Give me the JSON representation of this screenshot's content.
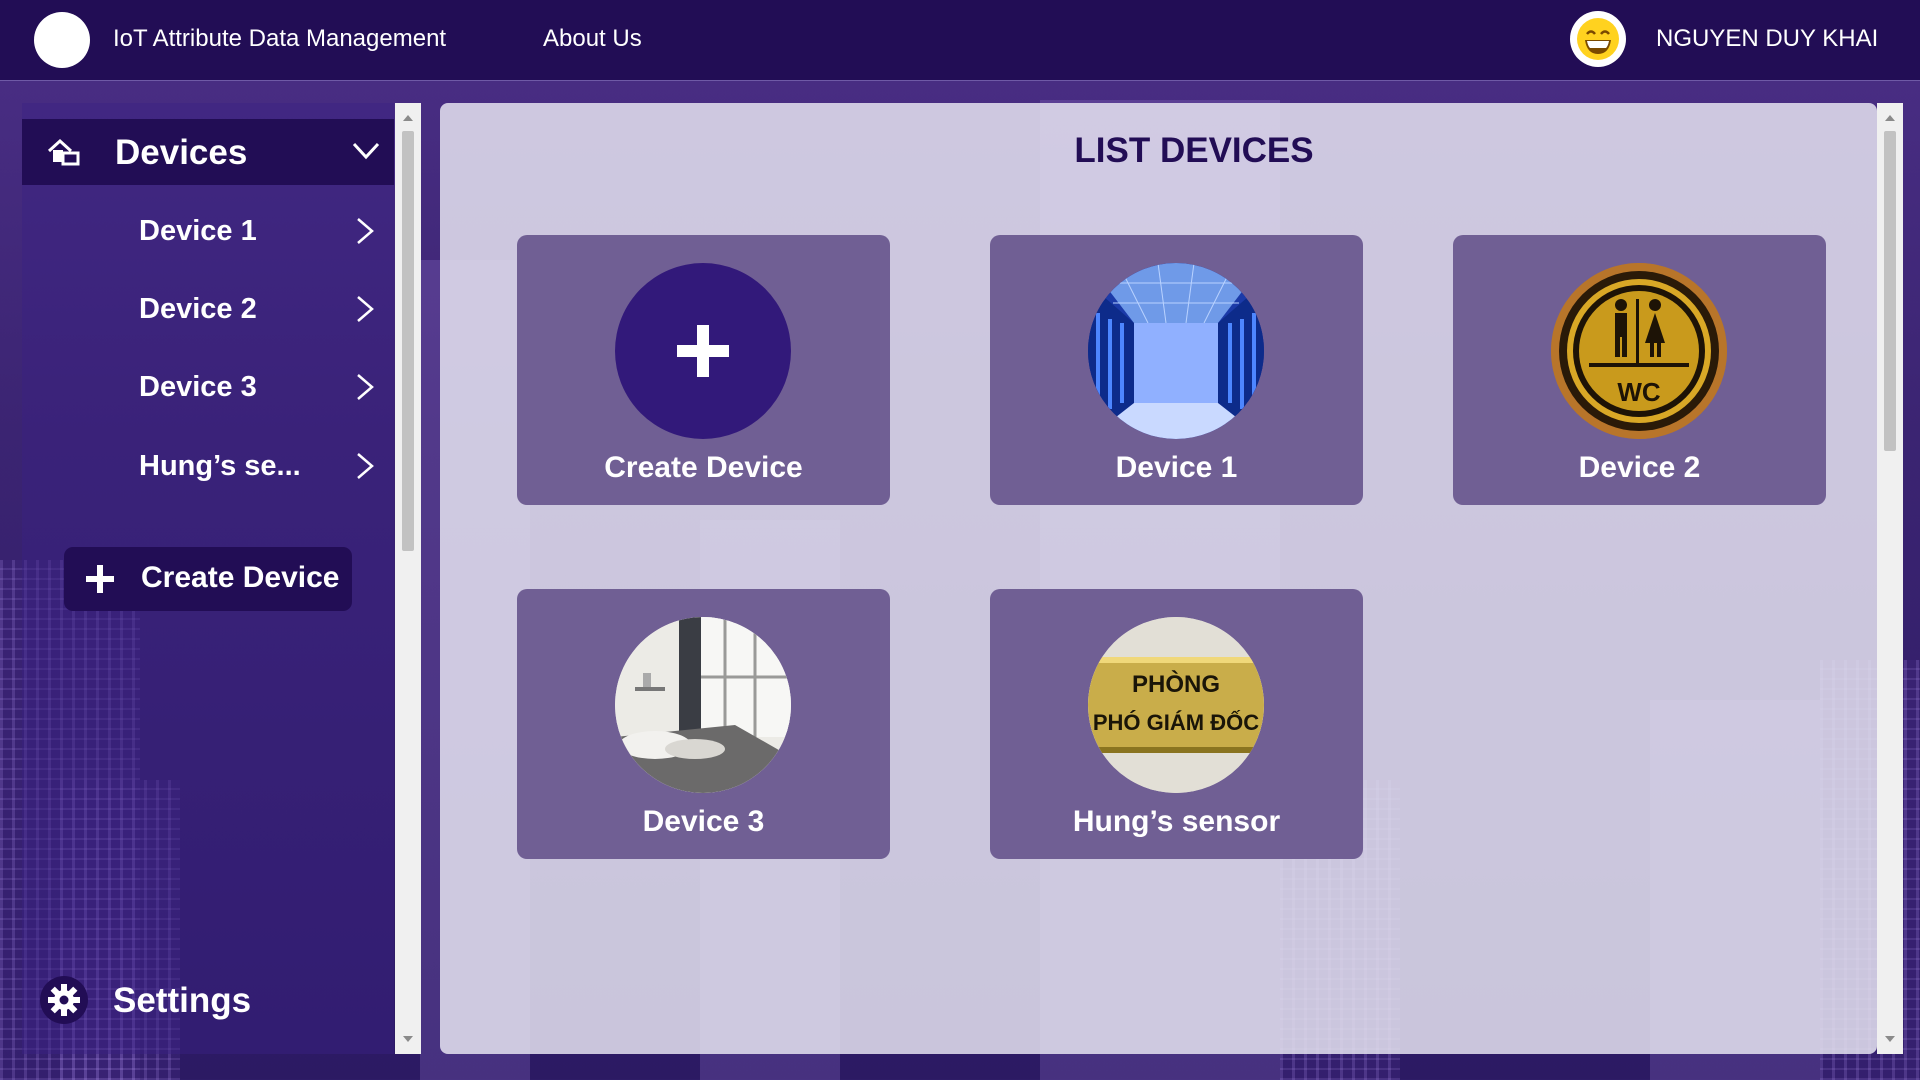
{
  "app": {
    "title": "IoT Attribute Data Management"
  },
  "nav": {
    "about_label": "About Us"
  },
  "user": {
    "name": "NGUYEN DUY KHAI"
  },
  "sidebar": {
    "header_label": "Devices",
    "items": [
      {
        "label": "Device 1"
      },
      {
        "label": "Device 2"
      },
      {
        "label": "Device 3"
      },
      {
        "label": "Hung’s se..."
      }
    ],
    "create_label": "Create Device",
    "settings_label": "Settings"
  },
  "main": {
    "title": "LIST DEVICES",
    "cards": [
      {
        "label": "Create Device",
        "image": "plus-icon"
      },
      {
        "label": "Device 1",
        "image": "server-room-photo"
      },
      {
        "label": "Device 2",
        "image": "wc-sign-photo"
      },
      {
        "label": "Device 3",
        "image": "bedroom-photo"
      },
      {
        "label": "Hung’s sensor",
        "image": "door-sign-photo",
        "sign_line1": "PHÒNG",
        "sign_line2": "PHÓ GIÁM ĐỐC"
      }
    ]
  },
  "colors": {
    "topbar": "#220d55",
    "accent_dark": "#220d55",
    "card_bg": "#705f94",
    "main_panel": "#e4e2f0"
  }
}
